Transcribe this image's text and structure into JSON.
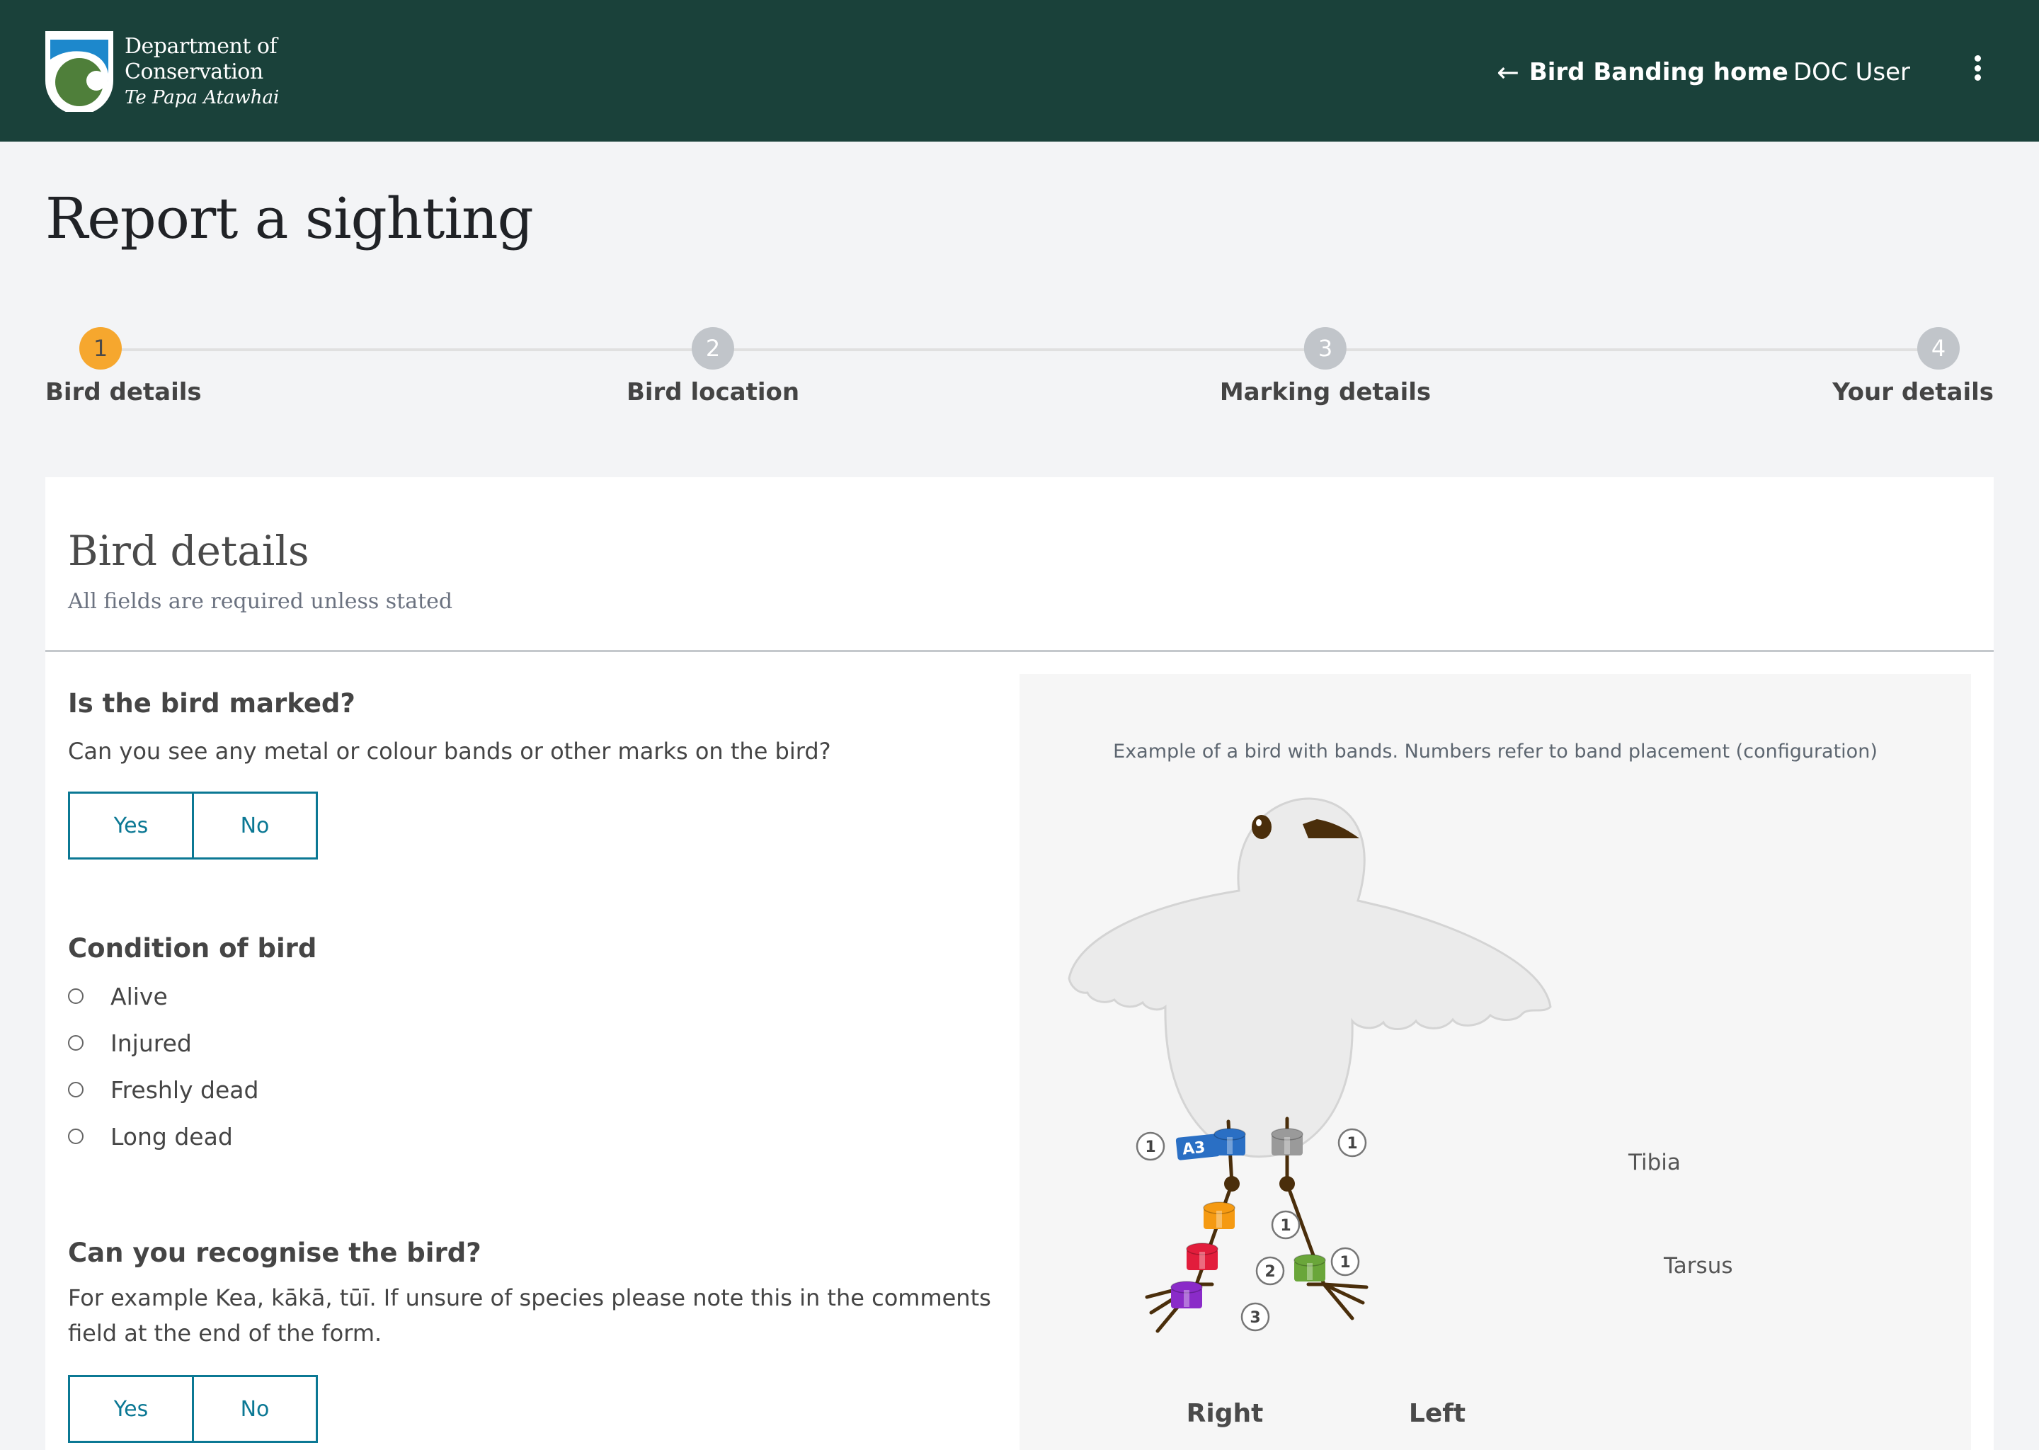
{
  "header": {
    "logo": {
      "icon": "doc-shield-logo",
      "line1": "Department of",
      "line2": "Conservation",
      "line3": "Te Papa Atawhai"
    },
    "nav_home": {
      "icon": "arrow-left-icon",
      "arrow": "←",
      "label": "Bird Banding home"
    },
    "user_label": "DOC User",
    "menu_icon": "more-vertical-icon"
  },
  "page_title": "Report a sighting",
  "stepper": {
    "current_step": 1,
    "steps": [
      {
        "number": "1",
        "label": "Bird details"
      },
      {
        "number": "2",
        "label": "Bird location"
      },
      {
        "number": "3",
        "label": "Marking details"
      },
      {
        "number": "4",
        "label": "Your details"
      }
    ]
  },
  "card": {
    "title": "Bird details",
    "subtitle": "All fields are required unless stated",
    "questions": {
      "marked": {
        "title": "Is the bird marked?",
        "description": "Can you see any metal or colour bands or other marks on the bird?",
        "yes_label": "Yes",
        "no_label": "No"
      },
      "condition": {
        "title": "Condition of bird",
        "options": [
          "Alive",
          "Injured",
          "Freshly dead",
          "Long dead"
        ]
      },
      "recognise": {
        "title": "Can you recognise the bird?",
        "description": "For example Kea, kākā, tūī. If unsure of species please note this in the comments field at the end of the form.",
        "yes_label": "Yes",
        "no_label": "No"
      }
    },
    "illustration": {
      "caption": "Example of a bird with bands. Numbers refer to band placement (configuration)",
      "tibia_label": "Tibia",
      "tarsus_label": "Tarsus",
      "right_label": "Right",
      "left_label": "Left",
      "bands": {
        "right_tibia": {
          "color": "#2a6fc4",
          "text": "A3",
          "position": "1"
        },
        "left_tibia": {
          "color": "#9a9a9a",
          "position": "1"
        },
        "right_tarsus": [
          {
            "color": "#f59a12",
            "position": "1"
          },
          {
            "color": "#e21d3c",
            "position": "2"
          },
          {
            "color": "#8a2bc8",
            "position": "3"
          }
        ],
        "left_tarsus": [
          {
            "color": "#6aa63a",
            "position": "1"
          }
        ]
      }
    }
  },
  "colors": {
    "header_bg": "#1a413a",
    "accent_teal": "#0b7894",
    "step_active": "#f6a72e",
    "step_inactive": "#c1c5ca",
    "page_bg": "#f3f4f6"
  }
}
